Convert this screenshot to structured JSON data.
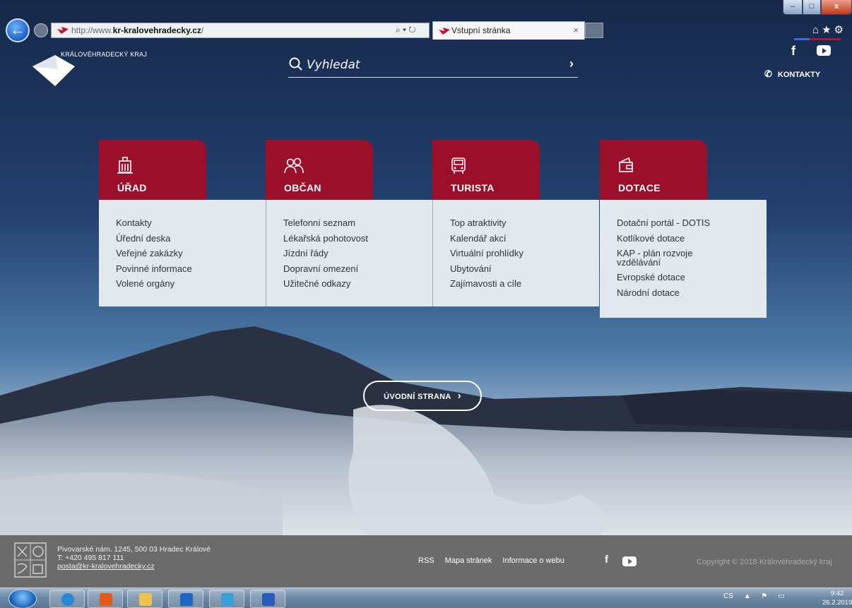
{
  "browser": {
    "url_prefix": "http://www.",
    "url_host": "kr-kralovehradecky.cz",
    "url_suffix": "/",
    "tab_title": "Vstupní stránka",
    "tab_close": "×",
    "addr_tools": "⌕ ▾ ↻",
    "back_glyph": "←",
    "forward_glyph": "→",
    "win_min": "–",
    "win_max": "□",
    "win_close": "x",
    "toolbar_glyphs": "⌂★⚙",
    "icons": [
      "back-arrow-icon",
      "forward-arrow-icon",
      "search-icon",
      "refresh-icon",
      "home-icon",
      "star-icon",
      "gear-icon"
    ]
  },
  "header": {
    "logo_text": "KRÁLOVÉHRADECKÝ KRAJ",
    "search_placeholder": "Vyhledat",
    "search_go": "›",
    "social_fb": "f",
    "contacts_phone": "✆",
    "contacts_label": "KONTAKTY"
  },
  "categories": [
    {
      "label": "ÚŘAD",
      "icon": "building-icon",
      "links": [
        "Kontakty",
        "Úřední deska",
        "Veřejné zakázky",
        "Povinné informace",
        "Volené orgány"
      ]
    },
    {
      "label": "OBČAN",
      "icon": "people-icon",
      "links": [
        "Telefonní seznam",
        "Lékařská pohotovost",
        "Jízdní řády",
        "Dopravní omezení",
        "Užitečné odkazy"
      ]
    },
    {
      "label": "TURISTA",
      "icon": "bus-icon",
      "links": [
        "Top atraktivity",
        "Kalendář akcí",
        "Virtuální prohlídky",
        "Ubytování",
        "Zajímavosti a cíle"
      ]
    },
    {
      "label": "DOTACE",
      "icon": "wallet-icon",
      "links": [
        "Dotační portál - DOTIS",
        "Kotlíkové dotace",
        "KAP - plán rozvoje vzdělávání",
        "Evropské dotace",
        "Národní dotace"
      ]
    }
  ],
  "home_button": {
    "label": "ÚVODNÍ STRANA",
    "arrow": "›"
  },
  "footer": {
    "address": "Pivovarské nám. 1245, 500 03 Hradec Králové",
    "phone": "T: +420 495 817 111",
    "email": "posta@kr-kralovehradecky.cz",
    "links": [
      "RSS",
      "Mapa stránek",
      "Informace o webu"
    ],
    "social_fb": "f",
    "copyright": "Copyright © 2018 Královéhradecký kraj"
  },
  "taskbar": {
    "apps": [
      "ie-icon",
      "media-icon",
      "folder-icon",
      "outlook-icon",
      "pen-icon",
      "word-icon"
    ],
    "lang": "CS",
    "tray_glyphs": "▲ ⚑ ▭",
    "time": "9:42",
    "date": "26.2.2019"
  },
  "colors": {
    "accent": "#9c0f2a",
    "panel": "#e3e7ee",
    "footer": "#6b6b6b",
    "sky": "#1b2f52"
  }
}
